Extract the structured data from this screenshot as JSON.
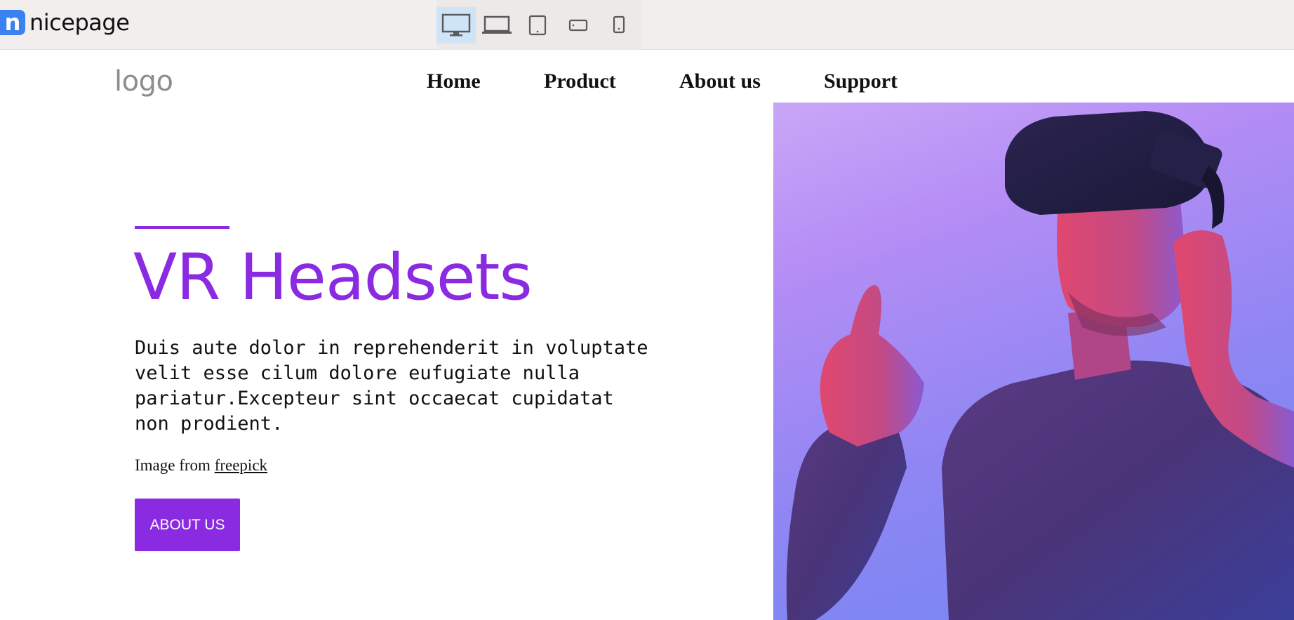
{
  "editor": {
    "brand_letter": "n",
    "brand_name": "nicepage",
    "devices": [
      {
        "name": "desktop-icon",
        "active": true
      },
      {
        "name": "laptop-icon",
        "active": false
      },
      {
        "name": "tablet-icon",
        "active": false
      },
      {
        "name": "phone-landscape-icon",
        "active": false
      },
      {
        "name": "phone-portrait-icon",
        "active": false
      }
    ]
  },
  "site": {
    "logo_text": "logo",
    "nav": [
      "Home",
      "Product",
      "About us",
      "Support"
    ],
    "hero": {
      "headline": "VR Headsets",
      "body": "Duis aute dolor in reprehenderit in voluptate velit esse cilum dolore eufugiate nulla pariatur.Excepteur sint occaecat cupidatat non prodient.",
      "credit_prefix": "Image from",
      "credit_link": "freepick",
      "button_label": "ABOUT US"
    }
  },
  "colors": {
    "accent": "#8a2be2",
    "brand_blue": "#3b82f0",
    "topbar_bg": "#f1eeed",
    "device_active_bg": "#cfe4f7"
  }
}
